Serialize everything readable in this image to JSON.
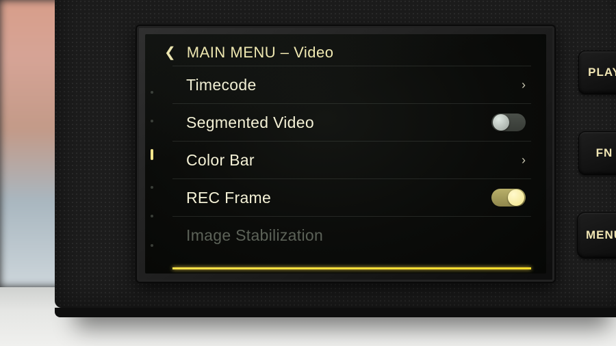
{
  "header": {
    "title": "MAIN MENU – Video"
  },
  "menu": {
    "items": [
      {
        "label": "Timecode",
        "control": "chevron",
        "state": null,
        "dim": false,
        "name": "menu-item-timecode"
      },
      {
        "label": "Segmented Video",
        "control": "toggle",
        "state": "off",
        "dim": false,
        "name": "menu-item-segmented-video"
      },
      {
        "label": "Color Bar",
        "control": "chevron",
        "state": null,
        "dim": false,
        "name": "menu-item-color-bar"
      },
      {
        "label": "REC Frame",
        "control": "toggle",
        "state": "on",
        "dim": false,
        "name": "menu-item-rec-frame"
      },
      {
        "label": "Image Stabilization",
        "control": "none",
        "state": null,
        "dim": true,
        "name": "menu-item-image-stabilization"
      }
    ],
    "page_dots": {
      "count": 6,
      "active_index": 2
    }
  },
  "buttons": {
    "play": "PLAY",
    "fn": "FN",
    "menu": "MENU"
  },
  "colors": {
    "accent": "#ffe14a",
    "text": "#f4f1d6",
    "text_dim": "#5c6258"
  }
}
